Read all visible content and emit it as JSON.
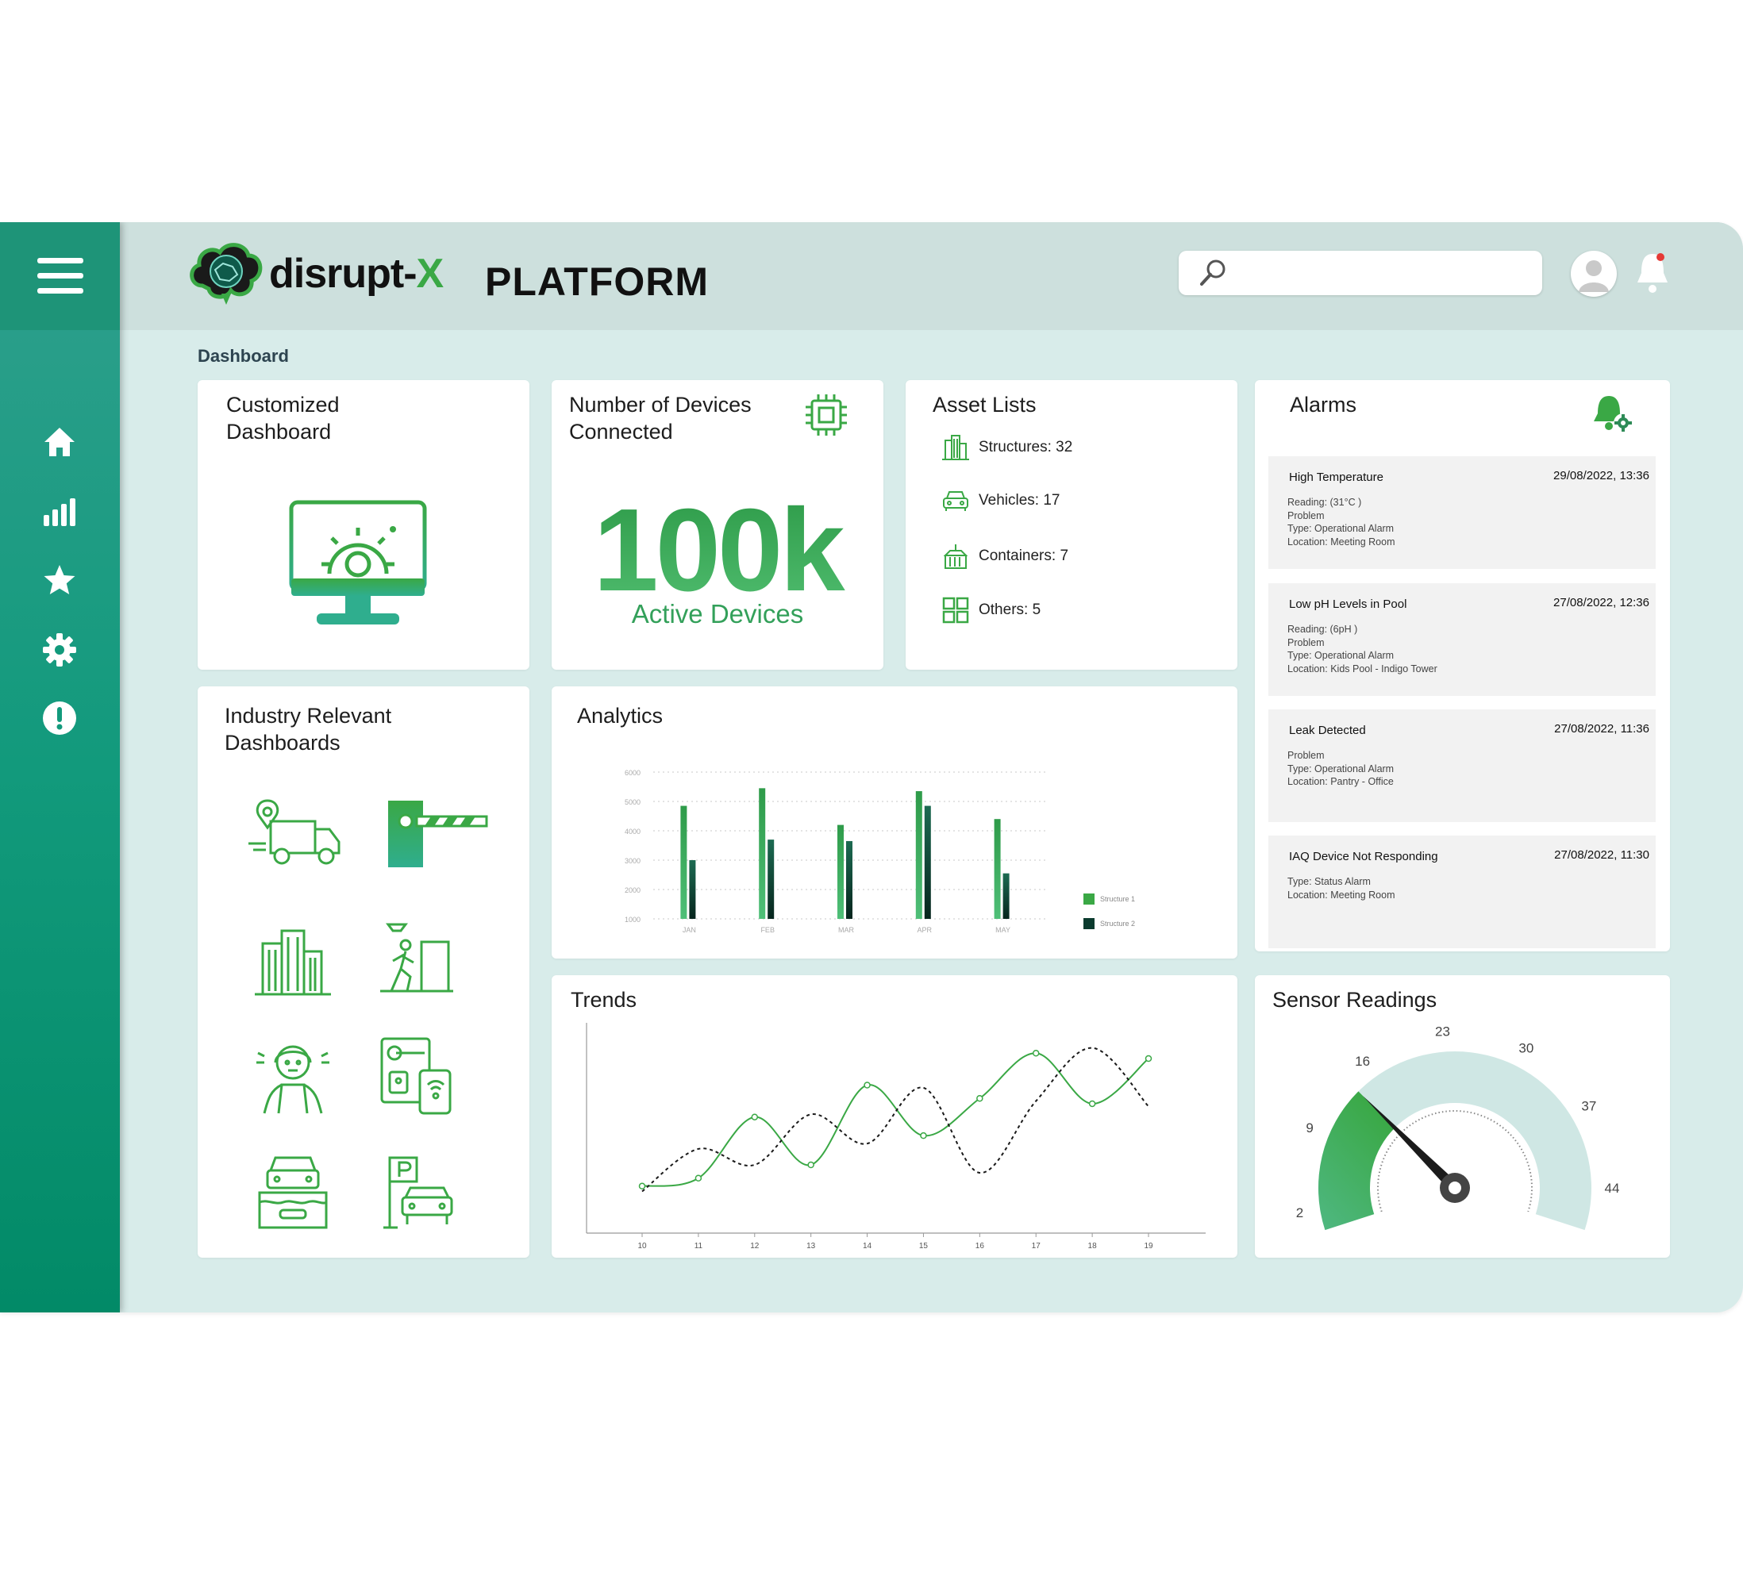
{
  "colors": {
    "accent": "#3aa845",
    "sidebar": "#129a7c",
    "teal_bg": "#d8ecea",
    "dark_green": "#0e3d33"
  },
  "header": {
    "logo_text_main": "disrupt-",
    "logo_text_x": "X",
    "platform_label": "PLATFORM",
    "search_placeholder": ""
  },
  "sidebar": {
    "items": [
      {
        "icon": "home-icon"
      },
      {
        "icon": "bar-chart-icon"
      },
      {
        "icon": "star-icon"
      },
      {
        "icon": "gear-icon"
      },
      {
        "icon": "alert-icon"
      }
    ]
  },
  "breadcrumb": "Dashboard",
  "customized_dashboard": {
    "title_line1": "Customized",
    "title_line2": "Dashboard"
  },
  "devices": {
    "title_line1": "Number of Devices",
    "title_line2": "Connected",
    "value": "100k",
    "subtitle": "Active Devices"
  },
  "assets": {
    "title": "Asset Lists",
    "items": [
      {
        "label": "Structures: 32",
        "icon": "building-icon"
      },
      {
        "label": "Vehicles: 17",
        "icon": "car-icon"
      },
      {
        "label": "Containers: 7",
        "icon": "container-icon"
      },
      {
        "label": "Others: 5",
        "icon": "grid-icon"
      }
    ]
  },
  "alarms": {
    "title": "Alarms",
    "items": [
      {
        "title": "High Temperature",
        "date": "29/08/2022, 13:36",
        "lines": [
          "Reading: (31°C )",
          "Problem",
          "Type: Operational Alarm",
          "Location: Meeting Room"
        ]
      },
      {
        "title": "Low pH Levels in Pool",
        "date": "27/08/2022, 12:36",
        "lines": [
          "Reading: (6pH )",
          "Problem",
          "Type: Operational Alarm",
          "Location: Kids Pool - Indigo Tower"
        ]
      },
      {
        "title": "Leak Detected",
        "date": "27/08/2022, 11:36",
        "lines": [
          "Problem",
          "Type: Operational Alarm",
          "Location: Pantry - Office"
        ]
      },
      {
        "title": "IAQ Device Not Responding",
        "date": "27/08/2022, 11:30",
        "lines": [
          "Type: Status Alarm",
          "Location: Meeting Room"
        ]
      }
    ]
  },
  "industry": {
    "title_line1": "Industry Relevant",
    "title_line2": "Dashboards"
  },
  "analytics": {
    "title": "Analytics"
  },
  "trends": {
    "title": "Trends"
  },
  "sensor": {
    "title": "Sensor Readings",
    "ticks": [
      "2",
      "9",
      "16",
      "23",
      "30",
      "37",
      "44"
    ],
    "value": 14,
    "min": 0,
    "max": 48
  },
  "chart_data": [
    {
      "type": "bar",
      "title": "Analytics",
      "categories": [
        "JAN",
        "FEB",
        "MAR",
        "APR",
        "MAY"
      ],
      "series": [
        {
          "name": "Structure 1",
          "values": [
            4850,
            5450,
            4200,
            5350,
            4400
          ]
        },
        {
          "name": "Structure 2",
          "values": [
            3000,
            3700,
            3650,
            4850,
            2550
          ]
        }
      ],
      "yticks": [
        "1000",
        "2000",
        "3000",
        "4000",
        "5000",
        "6000"
      ],
      "ylim": [
        1000,
        6000
      ],
      "legend": "right",
      "grid": true
    },
    {
      "type": "line",
      "title": "Trends",
      "x": [
        10,
        11,
        12,
        13,
        14,
        15,
        16,
        17,
        18,
        19
      ],
      "series": [
        {
          "style": "solid",
          "values": [
            1.2,
            1.5,
            3.8,
            2.0,
            5.0,
            3.1,
            4.5,
            6.2,
            4.3,
            6.0
          ]
        },
        {
          "style": "dotted",
          "values": [
            1.0,
            2.6,
            2.0,
            3.9,
            2.8,
            4.9,
            1.7,
            4.4,
            6.4,
            4.2
          ]
        }
      ],
      "xlabels": [
        "10",
        "11",
        "12",
        "13",
        "14",
        "15",
        "16",
        "17",
        "18",
        "19"
      ]
    }
  ]
}
